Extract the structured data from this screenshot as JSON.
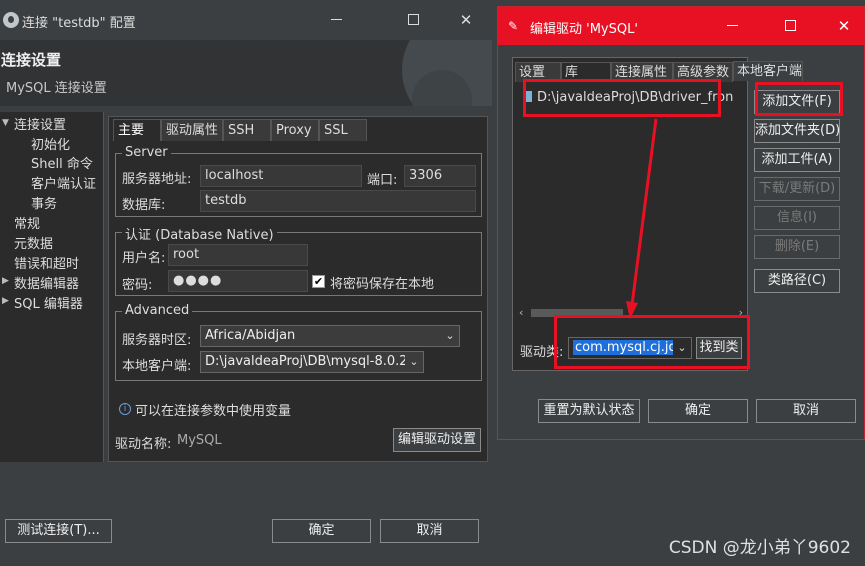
{
  "win1": {
    "title": "连接 \"testdb\" 配置",
    "header_title": "连接设置",
    "header_subtitle": "MySQL 连接设置",
    "nav": [
      {
        "label": "连接设置",
        "expandable": true
      },
      {
        "label": "初始化"
      },
      {
        "label": "Shell 命令"
      },
      {
        "label": "客户端认证"
      },
      {
        "label": "事务"
      },
      {
        "label": "常规"
      },
      {
        "label": "元数据"
      },
      {
        "label": "错误和超时"
      },
      {
        "label": "数据编辑器",
        "expandable": true
      },
      {
        "label": "SQL 编辑器",
        "expandable": true
      }
    ],
    "tabs": [
      "主要",
      "驱动属性",
      "SSH",
      "Proxy",
      "SSL"
    ],
    "server_group": "Server",
    "host_label": "服务器地址:",
    "host_value": "localhost",
    "port_label": "端口:",
    "port_value": "3306",
    "database_label": "数据库:",
    "database_value": "testdb",
    "auth_group": "认证 (Database Native)",
    "user_label": "用户名:",
    "user_value": "root",
    "password_label": "密码:",
    "password_value": "●●●●",
    "save_password_label": "将密码保存在本地",
    "save_password_checked": true,
    "advanced_group": "Advanced",
    "timezone_label": "服务器时区:",
    "timezone_value": "Africa/Abidjan",
    "client_label": "本地客户端:",
    "client_value": "D:\\javaldeaProj\\DB\\mysql-8.0.2",
    "variables_info": "可以在连接参数中使用变量",
    "driver_name_label": "驱动名称:",
    "driver_name_value": "MySQL",
    "edit_driver_button": "编辑驱动设置",
    "test_connection_button": "测试连接(T)...",
    "ok_button": "确定",
    "cancel_button": "取消"
  },
  "win2": {
    "title": "编辑驱动 'MySQL'",
    "tabs": [
      "设置",
      "库",
      "连接属性",
      "高级参数",
      "本地客户端"
    ],
    "library_item": "D:\\javaldeaProj\\DB\\driver_fron",
    "buttons": {
      "add_file": "添加文件(F)",
      "add_folder": "添加文件夹(D)",
      "add_artifact": "添加工件(A)",
      "download_update": "下载/更新(D)",
      "info": "信息(I)",
      "delete": "删除(E)",
      "classpath": "类路径(C)"
    },
    "driver_class_label": "驱动类:",
    "driver_class_value": "com.mysql.cj.jdl",
    "find_class_button": "找到类",
    "reset_button": "重置为默认状态",
    "ok_button": "确定",
    "cancel_button": "取消"
  },
  "watermark": "CSDN @龙小弟丫9602",
  "colors": {
    "highlight": "#e81123",
    "titlebar_active": "#e81123",
    "background": "#3c3f41"
  }
}
